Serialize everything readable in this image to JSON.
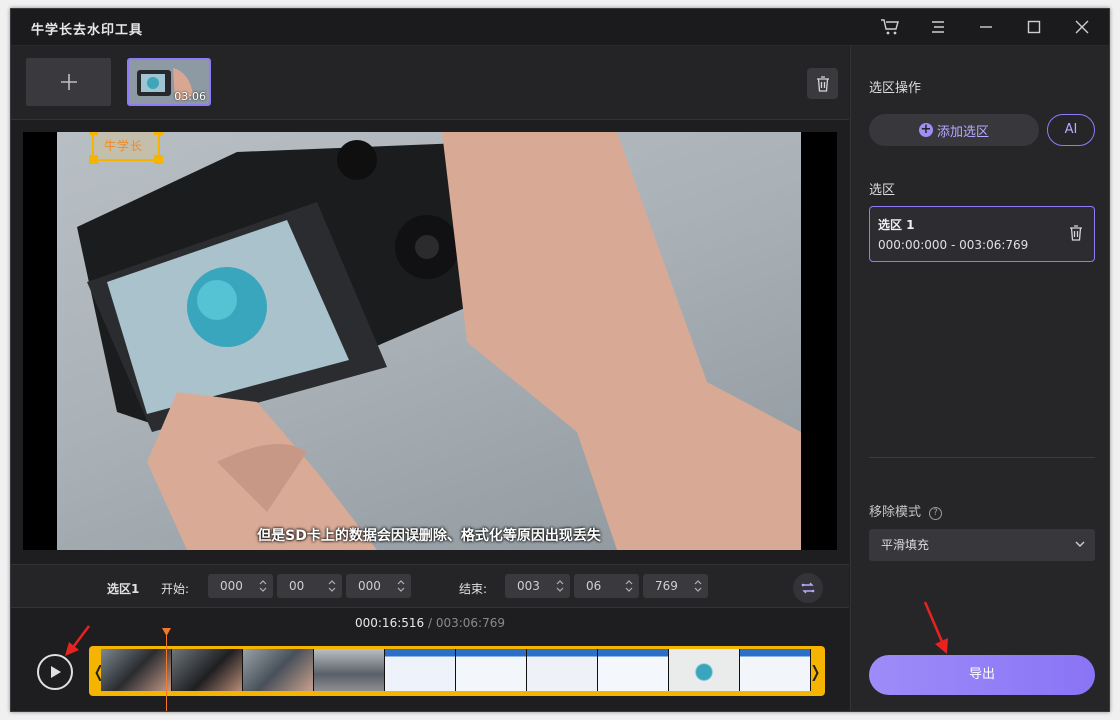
{
  "app": {
    "title": "牛学长去水印工具"
  },
  "media": {
    "clip_duration": "03:06"
  },
  "preview": {
    "watermark_text": "牛学长",
    "subtitle": "但是SD卡上的数据会因误删除、格式化等原因出现丢失"
  },
  "selection_row": {
    "name": "选区1",
    "start_label": "开始:",
    "end_label": "结束:",
    "start": [
      "000",
      "00",
      "000"
    ],
    "end": [
      "003",
      "06",
      "769"
    ]
  },
  "timeline": {
    "current": "000:16:516",
    "separator": " / ",
    "total": "003:06:769"
  },
  "panel": {
    "ops_title": "选区操作",
    "add_selection": "添加选区",
    "ai_label": "AI",
    "selection_title": "选区",
    "selection_item": {
      "name": "选区 1",
      "range": "000:00:000 - 003:06:769"
    },
    "mode_label": "移除模式",
    "mode_value": "平滑填充",
    "export_label": "导出"
  },
  "colors": {
    "accent": "#8f7bf7",
    "highlight": "#f4b400",
    "playhead": "#f07a2a",
    "annotation": "#e8231f"
  }
}
